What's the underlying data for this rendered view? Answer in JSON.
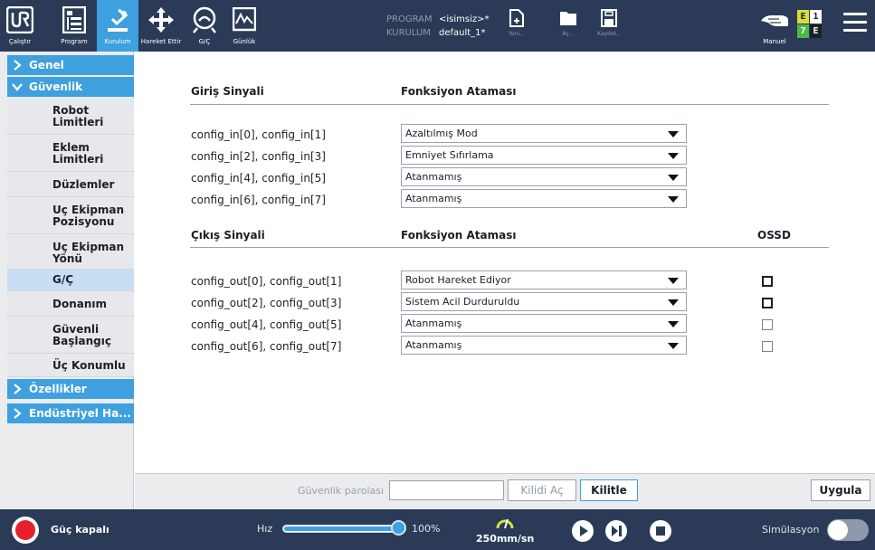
{
  "colors": {
    "topbar": "#2b3b57",
    "accent": "#3ea0de",
    "sidebar_selected": "#c7def3",
    "power": "#e4202e"
  },
  "topbar": {
    "nav": [
      {
        "label": "Çalıştır",
        "icon": "run-icon"
      },
      {
        "label": "Program",
        "icon": "program-icon"
      },
      {
        "label": "Kurulum",
        "icon": "installation-icon",
        "active": true
      },
      {
        "label": "Hareket Ettir",
        "icon": "move-icon"
      },
      {
        "label": "G/Ç",
        "icon": "io-icon"
      },
      {
        "label": "Günlük",
        "icon": "log-icon"
      }
    ],
    "program_key": "PROGRAM",
    "program_value": "<isimsiz>*",
    "installation_key": "KURULUM",
    "installation_value": "default_1*",
    "file_buttons": [
      {
        "label": "Yeni...",
        "icon": "new-file-icon"
      },
      {
        "label": "Aç...",
        "icon": "open-folder-icon"
      },
      {
        "label": "Kaydet...",
        "icon": "save-icon"
      }
    ],
    "mode_label": "Manuel",
    "badge": {
      "tl": "E",
      "tr": "1",
      "bl": "7",
      "br": "E"
    }
  },
  "sidebar": {
    "general": "Genel",
    "safety": "Güvenlik",
    "items": [
      "Robot Limitleri",
      "Eklem Limitleri",
      "Düzlemler",
      "Uç Ekipman Pozisyonu",
      "Uç Ekipman Yönü",
      "G/Ç",
      "Donanım",
      "Güvenli Başlangıç",
      "Üç Konumlu"
    ],
    "selected_index": 5,
    "features": "Özellikler",
    "industrial": "Endüstriyel Ha..."
  },
  "main": {
    "input_header": "Giriş Sinyali",
    "function_header": "Fonksiyon Ataması",
    "inputs": [
      {
        "signal": "config_in[0], config_in[1]",
        "value": "Azaltılmış Mod"
      },
      {
        "signal": "config_in[2], config_in[3]",
        "value": "Emniyet Sıfırlama"
      },
      {
        "signal": "config_in[4], config_in[5]",
        "value": "Atanmamış"
      },
      {
        "signal": "config_in[6], config_in[7]",
        "value": "Atanmamış"
      }
    ],
    "output_header": "Çıkış Sinyali",
    "function_header_2": "Fonksiyon Ataması",
    "ossd_header": "OSSD",
    "outputs": [
      {
        "signal": "config_out[0], config_out[1]",
        "value": "Robot Hareket Ediyor",
        "ossd": false,
        "ossd_enabled": true
      },
      {
        "signal": "config_out[2], config_out[3]",
        "value": "Sistem Acil Durduruldu",
        "ossd": false,
        "ossd_enabled": true
      },
      {
        "signal": "config_out[4], config_out[5]",
        "value": "Atanmamış",
        "ossd": false,
        "ossd_enabled": false
      },
      {
        "signal": "config_out[6], config_out[7]",
        "value": "Atanmamış",
        "ossd": false,
        "ossd_enabled": false
      }
    ]
  },
  "password": {
    "label": "Güvenlik parolası",
    "value": "",
    "unlock": "Kilidi Aç",
    "lock": "Kilitle",
    "apply": "Uygula"
  },
  "footer": {
    "power": "Güç kapalı",
    "speed_label": "Hız",
    "speed_percent": 100,
    "speed_text": "100%",
    "tcp_speed": "250mm/sn",
    "simulation": "Simülasyon",
    "simulation_on": false
  }
}
